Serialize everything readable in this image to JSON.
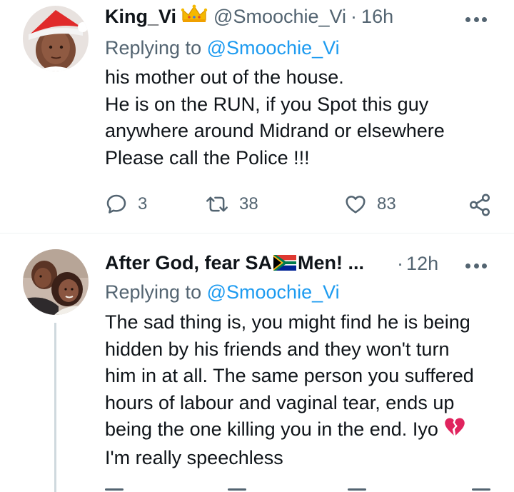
{
  "tweet1": {
    "display_name": "King_Vi",
    "handle": "@Smoochie_Vi",
    "separator": "·",
    "time": "16h",
    "replying_prefix": "Replying to",
    "replying_handle": "@Smoochie_Vi",
    "lines": [
      "his mother out of the house.",
      "He is on the RUN, if you Spot this guy",
      "anywhere around Midrand or elsewhere",
      "Please call the Police !!!"
    ],
    "reply_count": "3",
    "retweet_count": "38",
    "like_count": "83",
    "icons": {
      "reply": "speech-bubble-icon",
      "retweet": "retweet-arrows-icon",
      "like": "heart-outline-icon",
      "share": "share-nodes-icon",
      "badge": "crown-emoji-icon"
    }
  },
  "tweet2": {
    "display_name_before_flag": "After God, fear SA",
    "display_name_after_flag": "Men! ...",
    "separator": "·",
    "time": "12h",
    "replying_prefix": "Replying to",
    "replying_handle": "@Smoochie_Vi",
    "lines": [
      "The sad thing is, you might find he is being",
      "hidden by his friends and they won't turn",
      "him in at all. The same person you suffered",
      "hours of labour and vaginal tear, ends up",
      "being the one killing you in the end. Iyo",
      "I'm really speechless"
    ],
    "icons": {
      "flag": "south-africa-flag-icon",
      "emoji": "broken-heart-icon"
    }
  },
  "colors": {
    "link": "#1d9bf0",
    "muted": "#536471",
    "text": "#0f1419",
    "divider": "#eff3f4"
  }
}
